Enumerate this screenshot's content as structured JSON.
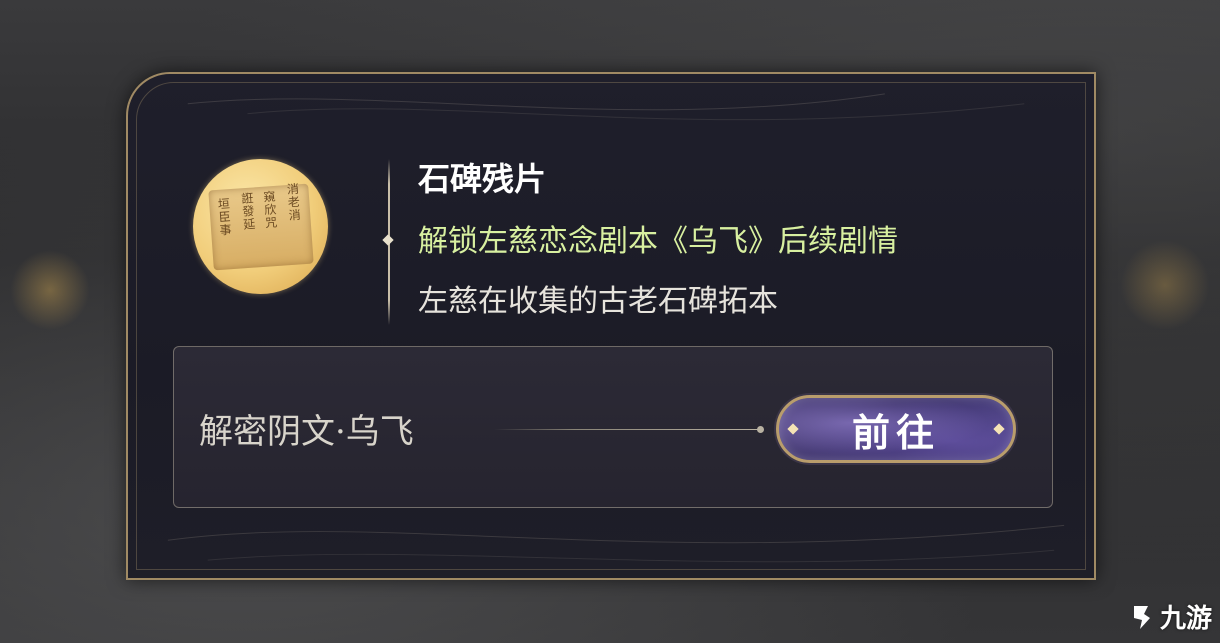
{
  "item": {
    "name": "石碑残片",
    "effect": "解锁左慈恋念剧本《乌飞》后续剧情",
    "description": "左慈在收集的古老石碑拓本",
    "icon": "stone-tablet-fragment-icon"
  },
  "source": {
    "label": "解密阴文·乌飞",
    "button_label": "前往"
  },
  "watermark": {
    "text": "九游"
  },
  "colors": {
    "accent_gold": "#a08a64",
    "effect_text": "#d8f0a0",
    "button_purple": "#3a3068",
    "dialog_bg": "#1f1f2b"
  }
}
